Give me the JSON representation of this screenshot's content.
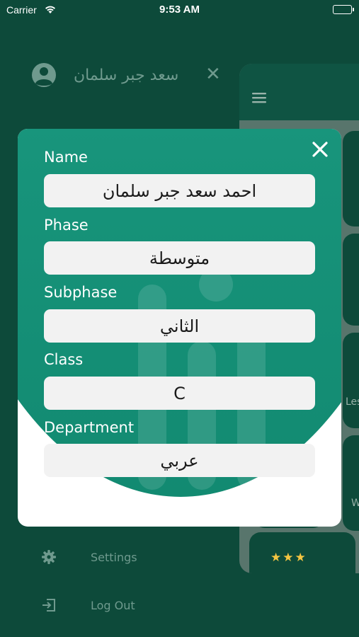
{
  "status_bar": {
    "carrier": "Carrier",
    "time": "9:53 AM"
  },
  "drawer": {
    "user_name": "سعد جبر سلمان",
    "items": [
      {
        "label": "Settings",
        "icon": "gear-icon"
      },
      {
        "label": "Log Out",
        "icon": "logout-icon"
      }
    ]
  },
  "main": {
    "labels": [
      "Les",
      "W"
    ]
  },
  "modal": {
    "fields": [
      {
        "label": "Name",
        "value": "احمد سعد جبر سلمان"
      },
      {
        "label": "Phase",
        "value": "متوسطة"
      },
      {
        "label": "Subphase",
        "value": "الثاني"
      },
      {
        "label": "Class",
        "value": "C"
      },
      {
        "label": "Department",
        "value": "عربي"
      }
    ]
  },
  "colors": {
    "background": "#0d4a3a",
    "accent": "#1a9a80",
    "field": "#f2f2f2"
  }
}
